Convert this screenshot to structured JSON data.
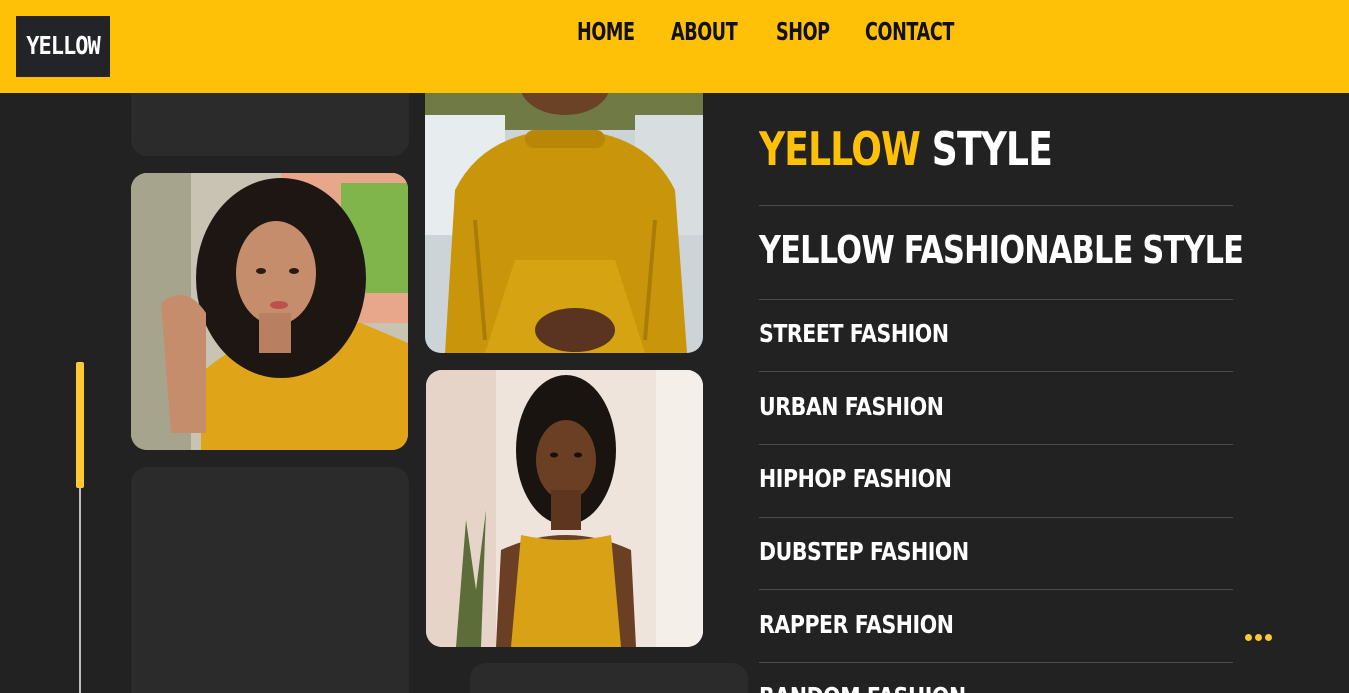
{
  "header": {
    "logo": "YELLOW",
    "nav": [
      "HOME",
      "ABOUT",
      "SHOP",
      "CONTACT"
    ]
  },
  "hero": {
    "title_accent": "YELLOW",
    "title_rest": "STYLE",
    "subtitle": "YELLOW FASHIONABLE STYLE"
  },
  "styles": [
    "STREET FASHION",
    "URBAN FASHION",
    "HIPHOP FASHION",
    "DUBSTEP FASHION",
    "RAPPER FASHION",
    "RANDOM FASHION"
  ],
  "gallery": {
    "photos": [
      "model-yellow-tshirt",
      "model-yellow-sweater",
      "model-yellow-dress"
    ]
  },
  "colors": {
    "accent": "#FFC107",
    "background": "#222222",
    "logo_bg": "#222427"
  },
  "icons": {
    "more": "more-dots-icon"
  }
}
